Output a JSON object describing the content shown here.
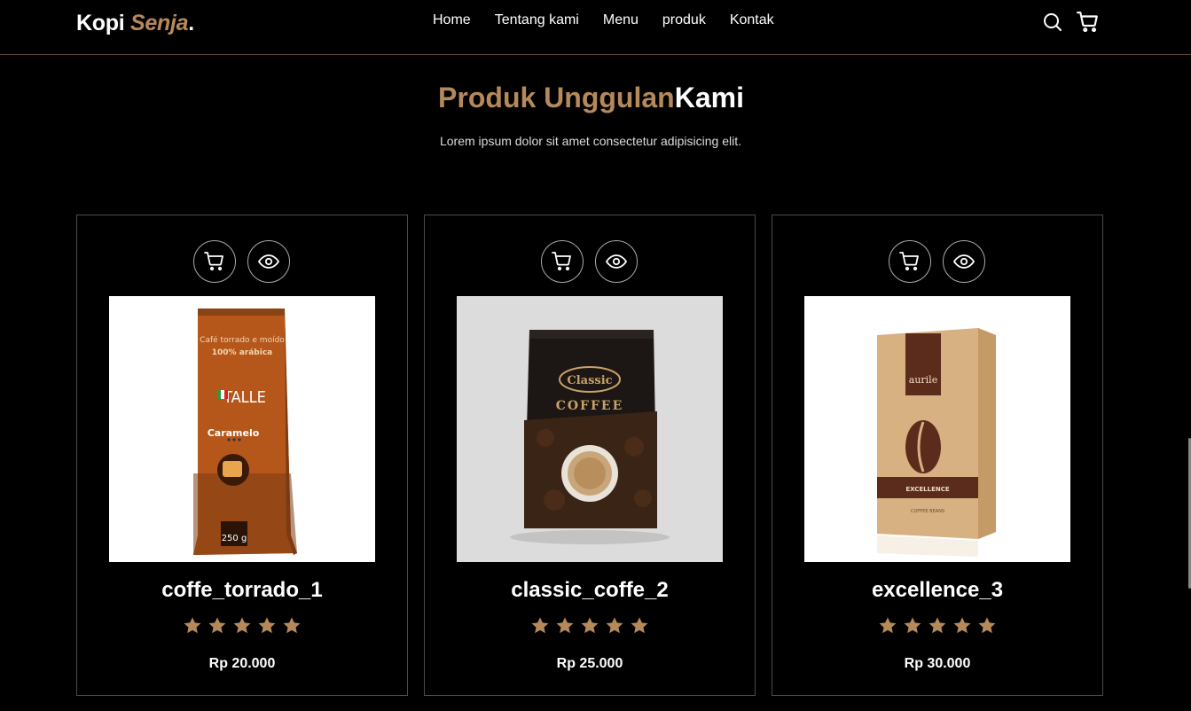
{
  "brand": {
    "name": "Kopi",
    "accent": "Senja",
    "dot": "."
  },
  "nav": [
    "Home",
    "Tentang kami",
    "Menu",
    "produk",
    "Kontak"
  ],
  "nav_icons": [
    "search-icon",
    "cart-icon"
  ],
  "section": {
    "title_accent": "Produk Unggulan",
    "title_rest": "Kami",
    "description": "Lorem ipsum dolor sit amet consectetur adipisicing elit."
  },
  "colors": {
    "accent": "#b6895b",
    "background": "#000000"
  },
  "products": [
    {
      "name": "coffe_torrado_1",
      "price": "Rp 20.000",
      "rating": 5,
      "bag_top_text": "Café torrado e moído",
      "bag_sub_text": "100% arábica",
      "bag_brand": "TALLE",
      "bag_flavor": "Caramelo",
      "bag_weight": "250 g"
    },
    {
      "name": "classic_coffe_2",
      "price": "Rp 25.000",
      "rating": 5,
      "bag_brand": "Classic",
      "bag_label": "COFFEE"
    },
    {
      "name": "excellence_3",
      "price": "Rp 30.000",
      "rating": 5,
      "bag_brand": "aurile",
      "bag_label": "EXCELLENCE",
      "bag_sub": "COFFEE BEANS"
    }
  ]
}
